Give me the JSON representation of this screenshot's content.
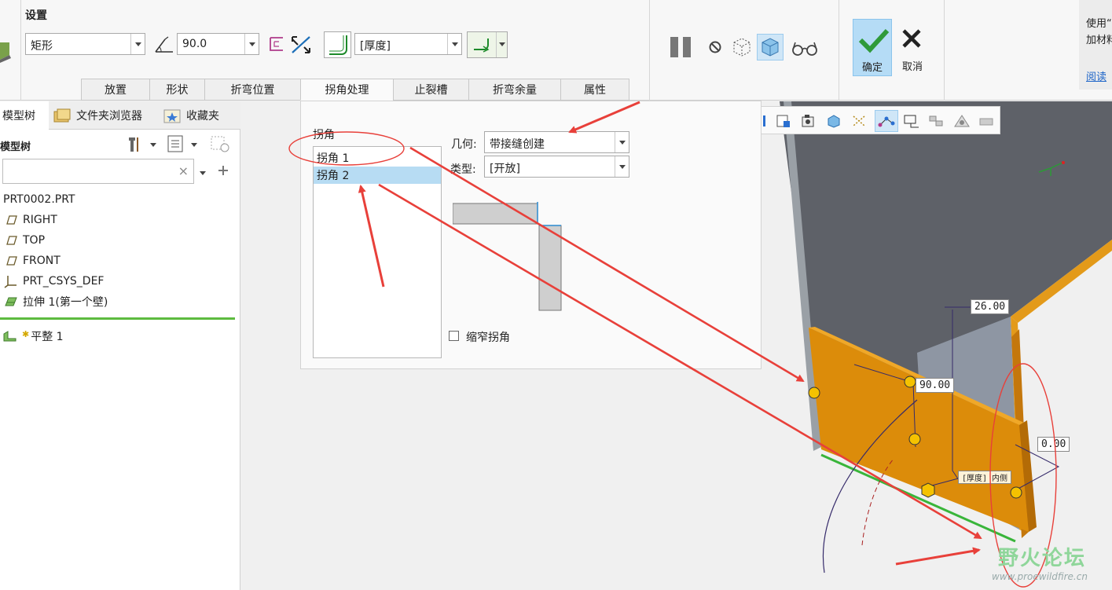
{
  "ribbon": {
    "settings_title": "设置",
    "shape_value": "矩形",
    "angle_value": "90.0",
    "thickness_value": "[厚度]",
    "tabs": [
      "放置",
      "形状",
      "折弯位置",
      "拐角处理",
      "止裂槽",
      "折弯余量",
      "属性"
    ],
    "active_tab": "拐角处理",
    "ok_label": "确定",
    "cancel_label": "取消",
    "help_line1": "使用“",
    "help_line2": "加材料",
    "help_link": "阅读"
  },
  "left_panel": {
    "tabs": [
      "模型树",
      "文件夹浏览器",
      "收藏夹"
    ],
    "tree_header": "模型树",
    "search_placeholder": "",
    "items": [
      {
        "label": "PRT0002.PRT",
        "icon": "part-icon"
      },
      {
        "label": "RIGHT",
        "icon": "datum-plane-icon"
      },
      {
        "label": "TOP",
        "icon": "datum-plane-icon"
      },
      {
        "label": "FRONT",
        "icon": "datum-plane-icon"
      },
      {
        "label": "PRT_CSYS_DEF",
        "icon": "csys-icon"
      },
      {
        "label": "拉伸 1(第一个壁)",
        "icon": "extrude-wall-icon"
      },
      {
        "label": "平整 1",
        "icon": "flat-wall-icon"
      }
    ]
  },
  "corner_panel": {
    "title": "拐角",
    "corners": [
      "拐角 1",
      "拐角 2"
    ],
    "selected_index": 1,
    "geometry_label": "几何:",
    "geometry_value": "带接缝创建",
    "type_label": "类型:",
    "type_value": "[开放]",
    "narrow_label": "缩窄拐角",
    "narrow_checked": false
  },
  "viewport": {
    "dimensions": [
      "26.00",
      "90.00",
      "0.00",
      "[厚度] 内侧"
    ],
    "watermark": "野火论坛",
    "watermark_url": "www.proewildfire.cn"
  },
  "colors": {
    "accent": "#b5dcf6",
    "annotation_red": "#e8403a",
    "flange_orange": "#dc8c0a",
    "model_gray": "#5e6168"
  }
}
